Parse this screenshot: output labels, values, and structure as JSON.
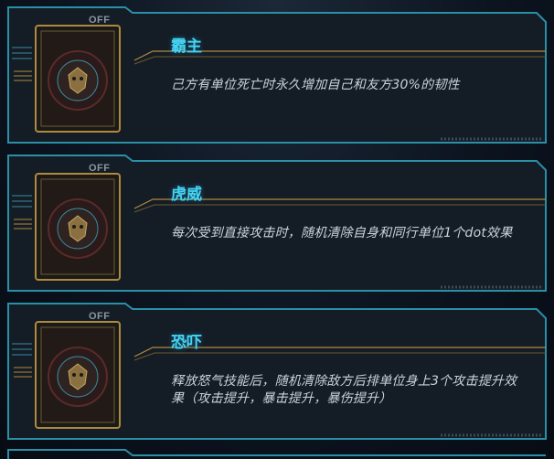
{
  "skills": [
    {
      "name": "霸主",
      "description": "己方有单位死亡时永久增加自己和友方30%的韧性",
      "status": "OFF",
      "icon": "tiger-emblem-icon"
    },
    {
      "name": "虎威",
      "description": "每次受到直接攻击时，随机清除自身和同行单位1个dot效果",
      "status": "OFF",
      "icon": "tiger-emblem-icon"
    },
    {
      "name": "恐吓",
      "description": "释放怒气技能后，随机清除敌方后排单位身上3个攻击提升效果（攻击提升，暴击提升，暴伤提升）",
      "status": "OFF",
      "icon": "tiger-emblem-icon"
    }
  ],
  "colors": {
    "title": "#45d4f2",
    "frame_border": "#2b8fa6",
    "gold": "#b08a3c",
    "description": "#c9d3da"
  }
}
